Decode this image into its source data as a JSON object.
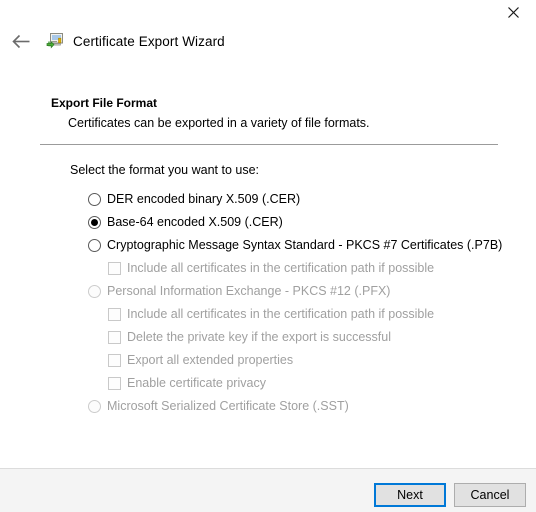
{
  "window": {
    "title": "Certificate Export Wizard",
    "close_label": "✕",
    "back_label": "←",
    "icon_name": "certificate-export-icon"
  },
  "page": {
    "heading": "Export File Format",
    "subheading": "Certificates can be exported in a variety of file formats.",
    "prompt": "Select the format you want to use:"
  },
  "options": [
    {
      "type": "radio",
      "label": "DER encoded binary X.509 (.CER)",
      "checked": false,
      "disabled": false,
      "name": "radio-der-encoded-binary"
    },
    {
      "type": "radio",
      "label": "Base-64 encoded X.509 (.CER)",
      "checked": true,
      "disabled": false,
      "name": "radio-base64-encoded"
    },
    {
      "type": "radio",
      "label": "Cryptographic Message Syntax Standard - PKCS #7 Certificates (.P7B)",
      "checked": false,
      "disabled": false,
      "name": "radio-pkcs7-certificates"
    },
    {
      "type": "checkbox",
      "label": "Include all certificates in the certification path if possible",
      "checked": false,
      "disabled": true,
      "name": "checkbox-include-all-certificates-pkcs7"
    },
    {
      "type": "radio",
      "label": "Personal Information Exchange - PKCS #12 (.PFX)",
      "checked": false,
      "disabled": true,
      "name": "radio-pkcs12-pfx"
    },
    {
      "type": "checkbox",
      "label": "Include all certificates in the certification path if possible",
      "checked": false,
      "disabled": true,
      "name": "checkbox-include-all-certificates-pfx"
    },
    {
      "type": "checkbox",
      "label": "Delete the private key if the export is successful",
      "checked": false,
      "disabled": true,
      "name": "checkbox-delete-private-key"
    },
    {
      "type": "checkbox",
      "label": "Export all extended properties",
      "checked": false,
      "disabled": true,
      "name": "checkbox-export-extended-properties"
    },
    {
      "type": "checkbox",
      "label": "Enable certificate privacy",
      "checked": false,
      "disabled": true,
      "name": "checkbox-enable-certificate-privacy"
    },
    {
      "type": "radio",
      "label": "Microsoft Serialized Certificate Store (.SST)",
      "checked": false,
      "disabled": true,
      "name": "radio-serialized-certificate-store"
    }
  ],
  "footer": {
    "next_label": "Next",
    "cancel_label": "Cancel"
  },
  "colors": {
    "accent": "#0078d7",
    "button_face": "#e1e1e1",
    "footer_bg": "#f4f4f4",
    "rule": "#9b9b9b",
    "disabled_text": "#a0a0a0"
  }
}
